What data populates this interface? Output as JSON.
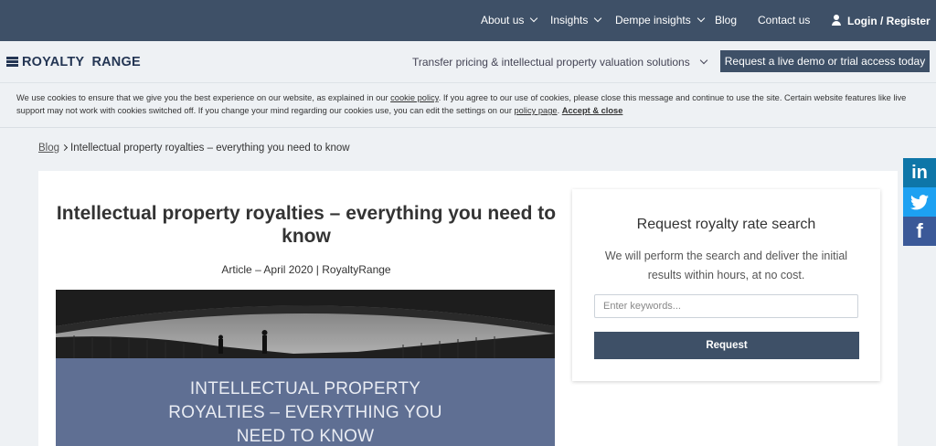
{
  "topnav": {
    "about": "About us",
    "insights": "Insights",
    "dempe": "Dempe insights",
    "blog": "Blog",
    "contact": "Contact us",
    "login": "Login / Register"
  },
  "header": {
    "logo": "ROYALTY  RANGE",
    "tagline": "Transfer pricing & intellectual property valuation solutions",
    "demo_button": "Request a live demo or trial access today"
  },
  "cookie": {
    "text1": "We use cookies to ensure that we give you the best experience on our website, as explained in our ",
    "link1": "cookie policy",
    "text2": ". If you agree to our use of cookies, please close this message and continue to use the site. Certain website features like live support may not work with cookies switched off. If you change your mind regarding our cookies use, you can edit the settings on our ",
    "link2": "policy page",
    "text3": ". ",
    "accept": "Accept & close"
  },
  "breadcrumb": {
    "blog": "Blog",
    "current": "Intellectual property royalties – everything you need to know"
  },
  "article": {
    "title": "Intellectual property royalties – everything you need to know",
    "meta": "Article – April 2020 | RoyaltyRange",
    "hero_text_line1": "INTELLECTUAL PROPERTY",
    "hero_text_line2": "ROYALTIES – EVERYTHING YOU",
    "hero_text_line3": "NEED TO KNOW"
  },
  "sidebar": {
    "title": "Request royalty rate search",
    "description": "We will perform the search and deliver the initial results within hours, at no cost.",
    "input_placeholder": "Enter keywords...",
    "button": "Request"
  },
  "social": {
    "linkedin": "in",
    "facebook": "f"
  },
  "colors": {
    "nav_bg": "#3e5067",
    "page_bg": "#eef1f4",
    "logo": "#243654",
    "linkedin": "#0e76a8",
    "twitter": "#1da1f2",
    "facebook": "#3b5998"
  }
}
